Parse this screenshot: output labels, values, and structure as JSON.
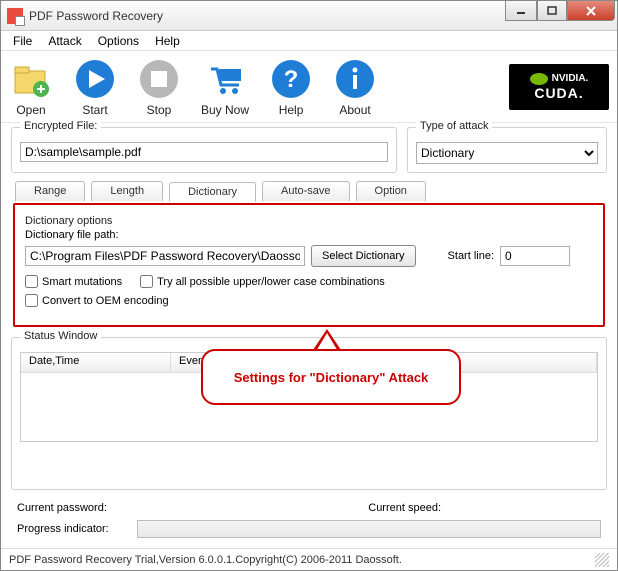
{
  "window": {
    "title": "PDF Password Recovery",
    "min": "—",
    "max": "▢",
    "close": "✕"
  },
  "menu": {
    "file": "File",
    "attack": "Attack",
    "options": "Options",
    "help": "Help"
  },
  "toolbar": {
    "open": "Open",
    "start": "Start",
    "stop": "Stop",
    "buynow": "Buy Now",
    "help": "Help",
    "about": "About",
    "cuda_brand": "NVIDIA.",
    "cuda_label": "CUDA."
  },
  "encrypted": {
    "legend": "Encrypted File:",
    "value": "D:\\sample\\sample.pdf"
  },
  "attack_type": {
    "legend": "Type of attack",
    "selected": "Dictionary"
  },
  "tabs": {
    "range": "Range",
    "length": "Length",
    "dictionary": "Dictionary",
    "autosave": "Auto-save",
    "option": "Option"
  },
  "dictionary": {
    "legend": "Dictionary options",
    "path_label": "Dictionary file path:",
    "path_value": "C:\\Program Files\\PDF Password Recovery\\DaossoftDictio",
    "select_btn": "Select Dictionary",
    "start_line_label": "Start line:",
    "start_line_value": "0",
    "smart_mutations": "Smart mutations",
    "try_cases": "Try all possible upper/lower case combinations",
    "oem": "Convert to OEM encoding"
  },
  "callout": {
    "text": "Settings for \"Dictionary\" Attack"
  },
  "status": {
    "legend": "Status Window",
    "col_datetime": "Date,Time",
    "col_event": "Event"
  },
  "footer": {
    "current_password_label": "Current password:",
    "current_password_value": "",
    "current_speed_label": "Current speed:",
    "current_speed_value": "",
    "progress_label": "Progress indicator:"
  },
  "statusbar": {
    "text": "PDF Password Recovery Trial,Version 6.0.0.1.Copyright(C) 2006-2011 Daossoft."
  }
}
